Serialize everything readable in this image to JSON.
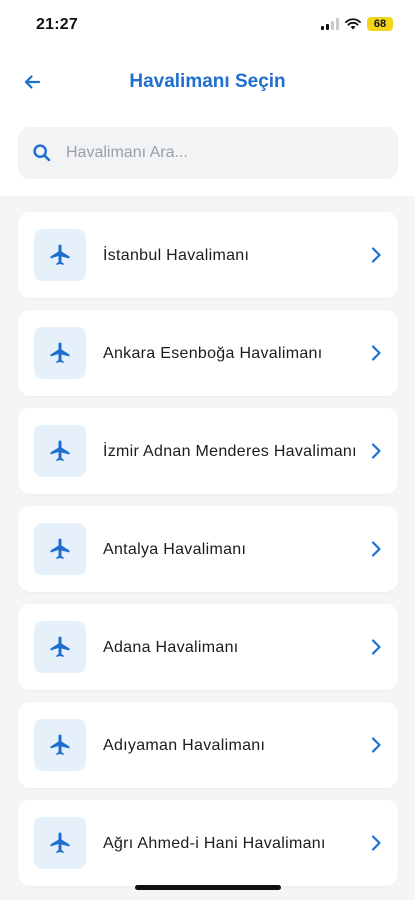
{
  "status_bar": {
    "time": "21:27",
    "battery": "68"
  },
  "header": {
    "title": "Havalimanı Seçin",
    "back_icon": "arrow-left-icon"
  },
  "search": {
    "placeholder": "Havalimanı Ara...",
    "value": "",
    "icon": "search-icon"
  },
  "airports": [
    {
      "name": "İstanbul Havalimanı"
    },
    {
      "name": "Ankara Esenboğa Havalimanı"
    },
    {
      "name": "İzmir Adnan Menderes Havalimanı"
    },
    {
      "name": "Antalya Havalimanı"
    },
    {
      "name": "Adana Havalimanı"
    },
    {
      "name": "Adıyaman Havalimanı"
    },
    {
      "name": "Ağrı Ahmed-i Hani Havalimanı"
    }
  ],
  "colors": {
    "accent": "#1f6fd1",
    "icon_bg": "#e6f0fb",
    "battery": "#f2d51a"
  }
}
